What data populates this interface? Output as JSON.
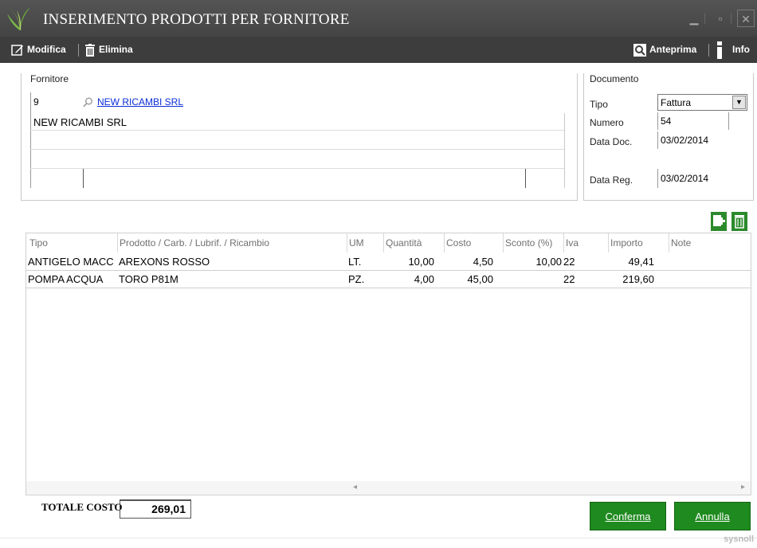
{
  "window": {
    "title": "INSERIMENTO PRODOTTI PER FORNITORE",
    "minimize_icon": "minimize-icon",
    "maximize_icon": "maximize-icon",
    "close_icon": "close-icon"
  },
  "toolbar": {
    "modifica": "Modifica",
    "elimina": "Elimina",
    "anteprima": "Anteprima",
    "info": "Info"
  },
  "fornitore": {
    "section_label": "Fornitore",
    "code": "9",
    "name_link": "NEW RICAMBI SRL",
    "name_line": "NEW RICAMBI SRL"
  },
  "documento": {
    "section_label": "Documento",
    "tipo_label": "Tipo",
    "tipo_value": "Fattura",
    "numero_label": "Numero",
    "numero_value": "54",
    "data_doc_label": "Data Doc.",
    "data_doc_value": "03/02/2014",
    "data_reg_label": "Data Reg.",
    "data_reg_value": "03/02/2014"
  },
  "grid": {
    "columns": [
      "Tipo",
      "Prodotto / Carb. / Lubrif. / Ricambio",
      "UM",
      "Quantità",
      "Costo",
      "Sconto (%)",
      "Iva",
      "Importo",
      "Note"
    ],
    "rows": [
      {
        "tipo": "ANTIGELO MACC",
        "prodotto": "AREXONS ROSSO",
        "um": "LT.",
        "quantita": "10,00",
        "costo": "4,50",
        "sconto": "10,00",
        "iva": "22",
        "importo": "49,41",
        "note": ""
      },
      {
        "tipo": "POMPA ACQUA",
        "prodotto": "TORO P81M",
        "um": "PZ.",
        "quantita": "4,00",
        "costo": "45,00",
        "sconto": "",
        "iva": "22",
        "importo": "219,60",
        "note": ""
      }
    ],
    "scroll_left": "◂",
    "scroll_right": "▸"
  },
  "footer": {
    "totale_label": "TOTALE COSTO",
    "totale_value": "269,01",
    "conferma": "Conferma",
    "annulla": "Annulla",
    "brand": "sysnoll"
  },
  "colors": {
    "titlebar": "#4a4a4a",
    "toolbar": "#3d3d3d",
    "accent_green": "#1f8a1f",
    "link": "#0a2dd8"
  }
}
